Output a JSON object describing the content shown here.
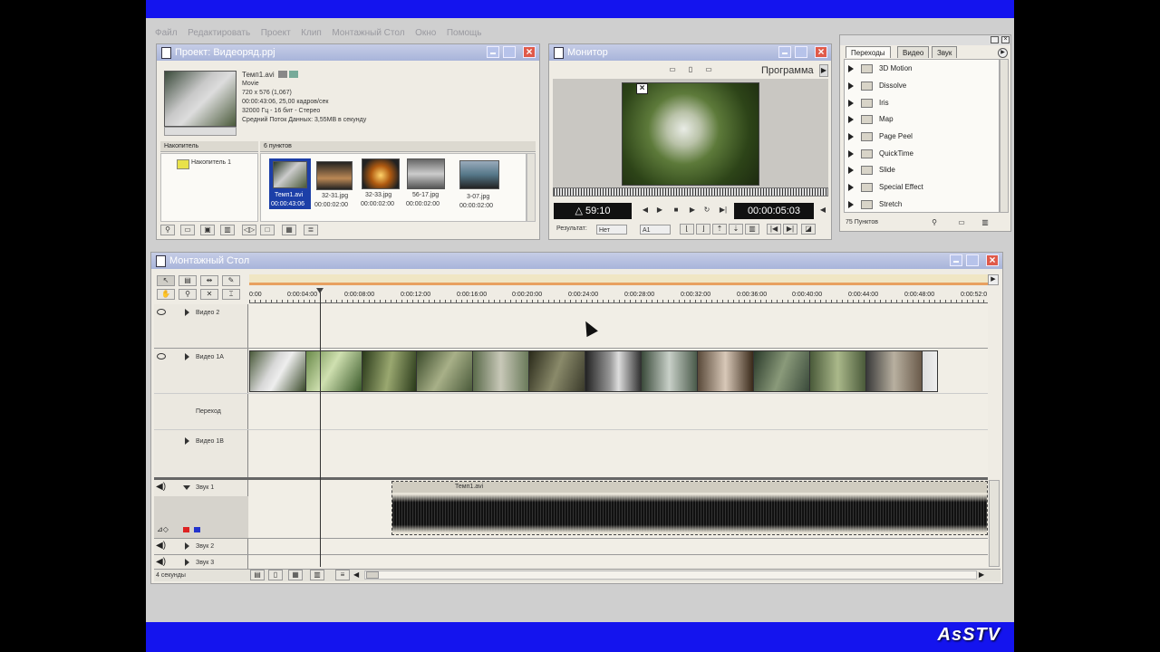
{
  "menu": [
    "Файл",
    "Редактировать",
    "Проект",
    "Клип",
    "Монтажный Стол",
    "Окно",
    "Помощь"
  ],
  "watermark": "AsSTV",
  "project": {
    "title": "Проект: Видеоряд.ppj",
    "clip_name": "Темп1.avi",
    "clip_info": [
      "Movie",
      "720 x 576 (1,067)",
      "00:00:43:06, 25,00 кадров/сек",
      "32000 Гц - 16 бит - Стерео",
      "Средний Поток Данных: 3,55MB в секунду"
    ],
    "bin_header": "Накопитель",
    "items_header": "6 пунктов",
    "bin_name": "Накопитель 1",
    "items": [
      {
        "name": "Темп1.avi",
        "time": "00:00:43:06",
        "selected": true
      },
      {
        "name": "32-31.jpg",
        "time": "00:00:02:00",
        "selected": false
      },
      {
        "name": "32-33.jpg",
        "time": "00:00:02:00",
        "selected": false
      },
      {
        "name": "56-17.jpg",
        "time": "00:00:02:00",
        "selected": false
      },
      {
        "name": "3-07.jpg",
        "time": "00:00:02:00",
        "selected": false
      }
    ]
  },
  "monitor": {
    "title": "Монитор",
    "program_label": "Программа",
    "timecode_left": "△ 59:10",
    "timecode_right": "00:00:05:03",
    "result_label": "Результат:",
    "result_value": "Нет",
    "track_value": "A1"
  },
  "transitions": {
    "tabs": [
      "Переходы",
      "Видео",
      "Звук"
    ],
    "items": [
      "3D Motion",
      "Dissolve",
      "Iris",
      "Map",
      "Page Peel",
      "QuickTime",
      "Slide",
      "Special Effect",
      "Stretch"
    ],
    "count": "75 Пунктов"
  },
  "timeline": {
    "title": "Монтажный Стол",
    "ruler": [
      "0:00",
      "0:00:04:00",
      "0:00:08:00",
      "0:00:12:00",
      "0:00:16:00",
      "0:00:20:00",
      "0:00:24:00",
      "0:00:28:00",
      "0:00:32:00",
      "0:00:36:00",
      "0:00:40:00",
      "0:00:44:00",
      "0:00:48:00",
      "0:00:52:0"
    ],
    "tracks": {
      "video2": "Видео 2",
      "video1a": "Видео 1А",
      "transition": "Переход",
      "video1b": "Видео 1В",
      "audio1": "Звук 1",
      "audio2": "Звук 2",
      "audio3": "Звук 3"
    },
    "audio_clip": "Темп1.avi",
    "zoom": "4 секунды"
  },
  "colors": {
    "blue_bar": "#1414ee",
    "title_gradient": "#a8b4da",
    "close_red": "#e05a4a",
    "selection_blue": "#1c3fa8"
  }
}
